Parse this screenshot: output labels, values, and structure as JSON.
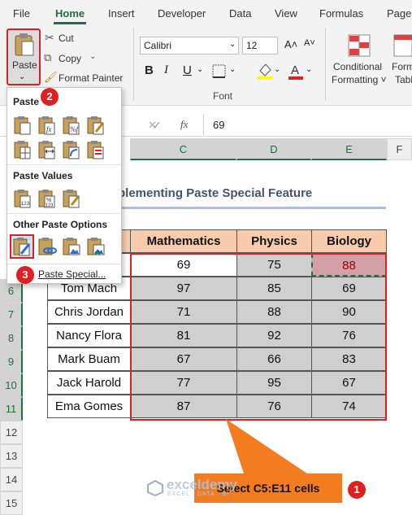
{
  "menu": {
    "items": [
      "File",
      "Home",
      "Insert",
      "Developer",
      "Data",
      "View",
      "Formulas",
      "Page"
    ]
  },
  "ribbon": {
    "paste_label": "Paste",
    "cut_label": "Cut",
    "copy_label": "Copy",
    "format_painter_label": "Format Painter",
    "font_name": "Calibri",
    "font_size": "12",
    "font_group_label": "Font",
    "bold": "B",
    "italic": "I",
    "underline": "U",
    "grow": "A˄",
    "shrink": "A˅",
    "conditional_formatting_line1": "Conditional",
    "conditional_formatting_line2": "Formatting ˅",
    "format_as_table_line1": "Forma",
    "format_as_table_line2": "Tabl"
  },
  "formula_bar": {
    "fx": "fx",
    "value": "69",
    "cancel": "✕",
    "confirm": "✓"
  },
  "paste_menu": {
    "paste_header": "Paste",
    "values_header": "Paste Values",
    "other_header": "Other Paste Options",
    "paste_special": "Paste Special..."
  },
  "grid": {
    "columns": [
      "C",
      "D",
      "E",
      "F"
    ],
    "rows": [
      "6",
      "7",
      "8",
      "9",
      "10",
      "11",
      "12",
      "13",
      "14",
      "15"
    ],
    "title": "plementing Paste Special Feature",
    "headers": [
      "Mathematics",
      "Physics",
      "Biology"
    ],
    "table": [
      {
        "name": "",
        "math": "69",
        "phys": "75",
        "bio": "88"
      },
      {
        "name": "Tom Mach",
        "math": "97",
        "phys": "85",
        "bio": "69"
      },
      {
        "name": "Chris Jordan",
        "math": "71",
        "phys": "88",
        "bio": "90"
      },
      {
        "name": "Nancy Flora",
        "math": "81",
        "phys": "92",
        "bio": "76"
      },
      {
        "name": "Mark Buam",
        "math": "67",
        "phys": "66",
        "bio": "83"
      },
      {
        "name": "Jack Harold",
        "math": "77",
        "phys": "95",
        "bio": "67"
      },
      {
        "name": "Ema Gomes",
        "math": "87",
        "phys": "76",
        "bio": "74"
      }
    ]
  },
  "annotations": {
    "badge1": "1",
    "badge2": "2",
    "badge3": "3",
    "callout": "Select C5:E11 cells",
    "watermark_main": "exceldemy",
    "watermark_sub": "EXCEL · DATA · BI"
  },
  "colors": {
    "accent": "#1e7145",
    "highlight": "#e02020",
    "header_fill": "#f8cbad",
    "callout": "#f47c20"
  }
}
